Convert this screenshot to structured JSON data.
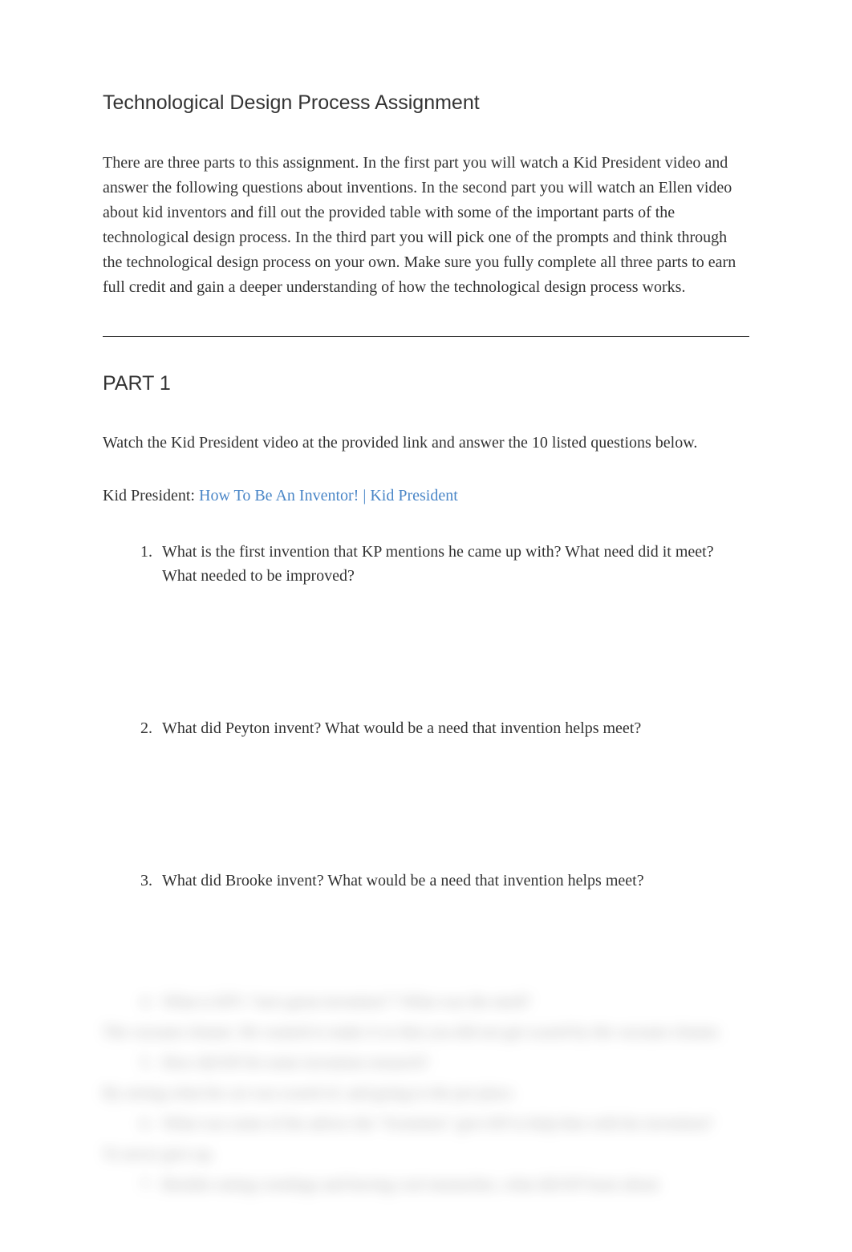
{
  "title": "Technological Design Process Assignment",
  "intro": "There are three parts to this assignment. In the first part you will watch a Kid President video and answer the following questions about inventions. In the second part you will watch an Ellen video about kid inventors and fill out the provided table with some of the important parts of the technological design process. In the third part you will pick one of the prompts and think through the technological design process on your own. Make sure you fully complete all three parts to earn full credit and gain a deeper understanding of how the technological design process works.",
  "part1": {
    "heading": "PART 1",
    "intro": "Watch the Kid President video at the provided link and answer the 10 listed questions below.",
    "link_prefix": "Kid President:  ",
    "link_text": "How To Be An Inventor! | Kid President",
    "questions": [
      {
        "num": "1.",
        "text": "What is the first invention that KP mentions he came up with? What need did it meet? What needed to be improved?"
      },
      {
        "num": "2.",
        "text": "What did Peyton invent? What would be a need that invention helps meet?"
      },
      {
        "num": "3.",
        "text": "What did Brooke invent? What would be a need that invention helps meet?"
      }
    ]
  },
  "blurred": {
    "q4_num": "4.",
    "q4_text": "What is KP's \"next great invention\"? What was the need?",
    "line1": "The vacuum cleaner. He wanted to make it so that you did not get scared by the vacuum cleaner.",
    "q5_num": "5.",
    "q5_text": "How did KP do some invention research?",
    "line2": "By seeing what his cat was scared of, and going to the pet place.",
    "q6_num": "6.",
    "q6_text": "What was some of the advice the \"Scientists\" give KP to help him with his invention?",
    "line3": "To never give up.",
    "q7_num": "7.",
    "q7_text": "Besides eating corndogs and having cool mustaches, what did KP learn about"
  }
}
